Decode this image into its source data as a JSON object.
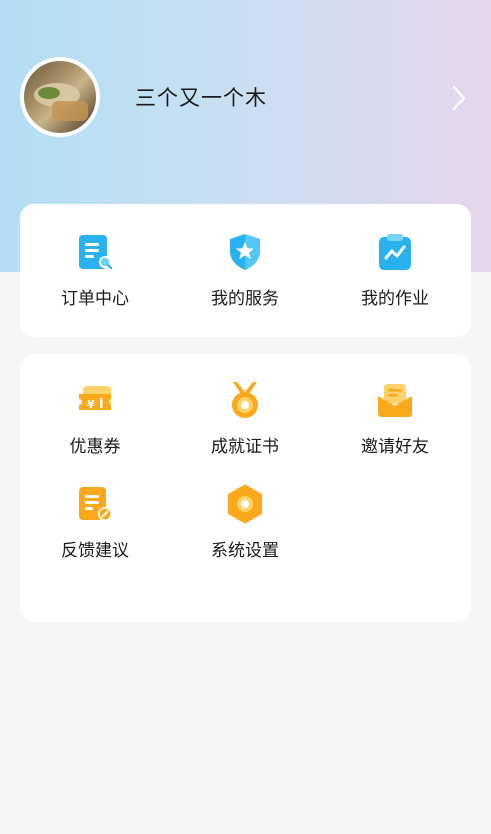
{
  "profile": {
    "username": "三个又一个木"
  },
  "services": [
    {
      "label": "订单中心",
      "icon": "order-icon"
    },
    {
      "label": "我的服务",
      "icon": "shield-star-icon"
    },
    {
      "label": "我的作业",
      "icon": "clipboard-chart-icon"
    }
  ],
  "tools": [
    {
      "label": "优惠券",
      "icon": "coupon-icon"
    },
    {
      "label": "成就证书",
      "icon": "medal-icon"
    },
    {
      "label": "邀请好友",
      "icon": "envelope-icon"
    },
    {
      "label": "反馈建议",
      "icon": "feedback-edit-icon"
    },
    {
      "label": "系统设置",
      "icon": "settings-icon"
    }
  ],
  "colors": {
    "accent_blue": "#29b2ef",
    "accent_orange": "#f9a91b",
    "hero_left": "#b3def5",
    "hero_right": "#e7d6ec"
  }
}
